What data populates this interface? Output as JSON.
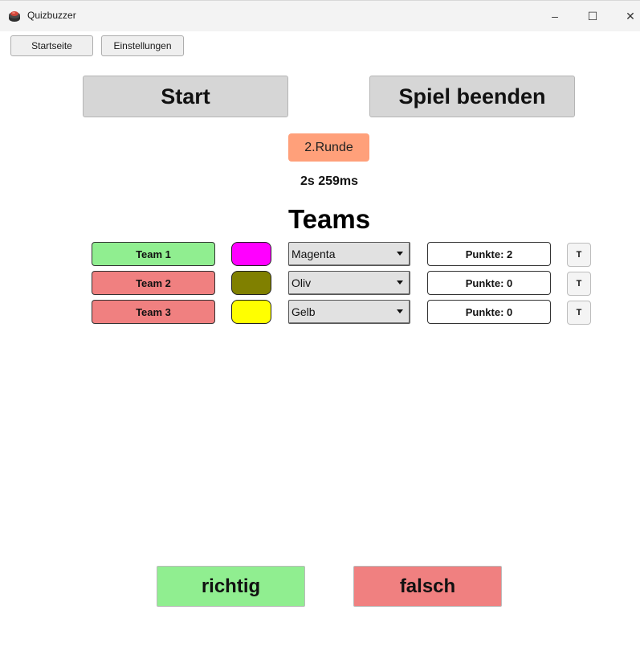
{
  "window": {
    "title": "Quizbuzzer",
    "icon": "quizbuzzer-app-icon",
    "controls": {
      "minimize": "–",
      "maximize": "☐",
      "close": "✕"
    }
  },
  "nav": {
    "home_label": "Startseite",
    "settings_label": "Einstellungen"
  },
  "main": {
    "start_label": "Start",
    "end_label": "Spiel beenden",
    "round_label": "2.Runde",
    "round_color": "#ffa07a",
    "timer": "2s 259ms",
    "teams_heading": "Teams"
  },
  "teams": [
    {
      "name": "Team 1",
      "status_color": "#90ee90",
      "swatch": "#ff00ff",
      "color_name": "Magenta",
      "points_label": "Punkte: 2",
      "t_label": "T"
    },
    {
      "name": "Team 2",
      "status_color": "#f08080",
      "swatch": "#808000",
      "color_name": "Oliv",
      "points_label": "Punkte: 0",
      "t_label": "T"
    },
    {
      "name": "Team 3",
      "status_color": "#f08080",
      "swatch": "#ffff00",
      "color_name": "Gelb",
      "points_label": "Punkte: 0",
      "t_label": "T"
    }
  ],
  "answer": {
    "correct_label": "richtig",
    "correct_color": "#90ee90",
    "wrong_label": "falsch",
    "wrong_color": "#f08080"
  }
}
